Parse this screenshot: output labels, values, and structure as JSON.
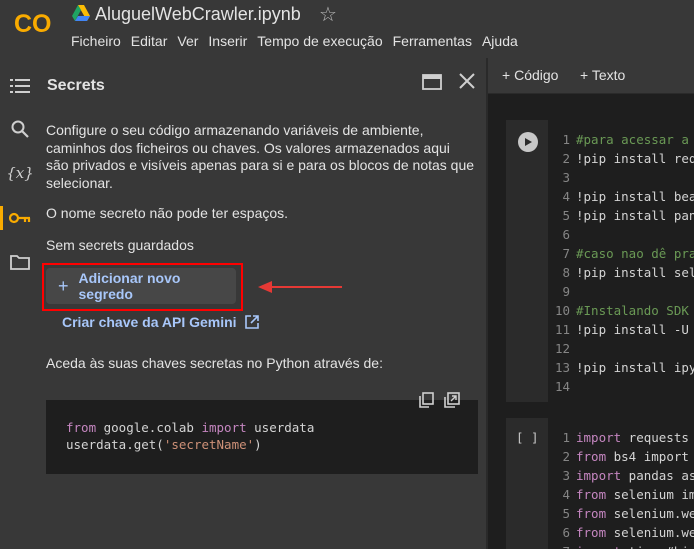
{
  "header": {
    "notebook_title": "AluguelWebCrawler.ipynb",
    "menu": [
      "Ficheiro",
      "Editar",
      "Ver",
      "Inserir",
      "Tempo de execução",
      "Ferramentas",
      "Ajuda"
    ]
  },
  "rail": {
    "icons": [
      "table-of-contents-icon",
      "search-icon",
      "variables-icon",
      "key-icon",
      "folder-icon"
    ],
    "active": "key-icon"
  },
  "secrets_panel": {
    "title": "Secrets",
    "description": "Configure o seu código armazenando variáveis de ambiente, caminhos dos ficheiros ou chaves. Os valores armazenados aqui são privados e visíveis apenas para si e para os blocos de notas que selecionar.",
    "note": "O nome secreto não pode ter espaços.",
    "empty_state": "Sem secrets guardados",
    "add_button_label": "Adicionar novo segredo",
    "gemini_link_label": "Criar chave da API Gemini",
    "access_text": "Aceda às suas chaves secretas no Python através de:",
    "snippet_lines": [
      [
        "from",
        " google.colab ",
        "import",
        " userdata"
      ],
      [
        "userdata.get(",
        "'secretName'",
        ")"
      ]
    ]
  },
  "notebook": {
    "add_code_label": "Código",
    "add_text_label": "Texto",
    "cell1_lines": [
      {
        "n": "1",
        "t": "#para acessar a",
        "c": "cm"
      },
      {
        "n": "2",
        "t": "!pip install req",
        "c": "tx"
      },
      {
        "n": "3",
        "t": "",
        "c": "tx"
      },
      {
        "n": "4",
        "t": "!pip install bea",
        "c": "tx"
      },
      {
        "n": "5",
        "t": "!pip install pan",
        "c": "tx"
      },
      {
        "n": "6",
        "t": "",
        "c": "tx"
      },
      {
        "n": "7",
        "t": "#caso nao dê pra",
        "c": "cm"
      },
      {
        "n": "8",
        "t": "!pip install sel",
        "c": "tx"
      },
      {
        "n": "9",
        "t": "",
        "c": "tx"
      },
      {
        "n": "10",
        "t": "#Instalando SDK",
        "c": "cm"
      },
      {
        "n": "11",
        "t": "!pip install -U",
        "c": "tx"
      },
      {
        "n": "12",
        "t": "",
        "c": "tx"
      },
      {
        "n": "13",
        "t": "!pip install ipy",
        "c": "tx"
      },
      {
        "n": "14",
        "t": "",
        "c": "tx"
      }
    ],
    "cell2_status": "[ ]",
    "cell2_lines": [
      {
        "n": "1",
        "k": "import",
        "t": " requests"
      },
      {
        "n": "2",
        "k": "from",
        "t": " bs4 import"
      },
      {
        "n": "3",
        "k": "import",
        "t": " pandas as"
      },
      {
        "n": "4",
        "k": "from",
        "t": " selenium im"
      },
      {
        "n": "5",
        "k": "from",
        "t": " selenium.we"
      },
      {
        "n": "6",
        "k": "from",
        "t": " selenium.we"
      },
      {
        "n": "7",
        "k": "import",
        "t": " time #bi"
      }
    ]
  }
}
